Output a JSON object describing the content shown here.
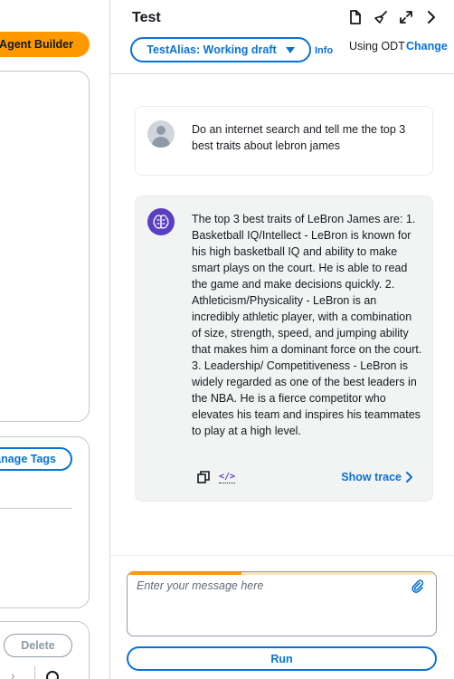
{
  "left_panel": {
    "agent_builder_label": "Agent Builder",
    "manage_tags_label": "anage Tags",
    "delete_label": "Delete"
  },
  "test_panel": {
    "title": "Test",
    "alias_select_value": "TestAlias: Working draft",
    "info_label": "Info",
    "odt_label": "Using ODT",
    "change_label": "Change",
    "header_icons": [
      "document-icon",
      "broom-icon",
      "expand-icon",
      "chevron-right-icon"
    ]
  },
  "chat": {
    "user_message": "Do an internet search and tell me the top 3 best traits about lebron james",
    "bot_message": "The top 3 best traits of LeBron James are: 1. Basketball IQ/Intellect - LeBron is known for his high basketball IQ and ability to make smart plays on the court. He is able to read the game and make decisions quickly. 2. Athleticism/Physicality - LeBron is an incredibly athletic player, with a combination of size, strength, speed, and jumping ability that makes him a dominant force on the court. 3. Leadership/ Competitiveness - LeBron is widely regarded as one of the best leaders in the NBA. He is a fierce competitor who elevates his team and inspires his teammates to play at a high level.",
    "show_trace_label": "Show trace"
  },
  "composer": {
    "placeholder": "Enter your message here",
    "progress": 0.37,
    "run_label": "Run"
  },
  "colors": {
    "accent": "#0972d3",
    "brand": "#ff9900",
    "bot_avatar": "#5a3fc0"
  }
}
